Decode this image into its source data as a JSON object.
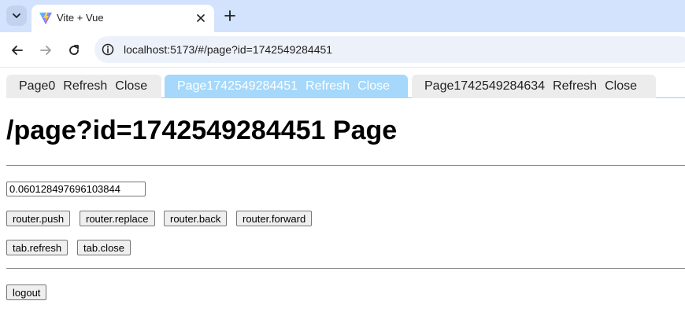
{
  "browser": {
    "tab_title": "Vite + Vue",
    "url": "localhost:5173/#/page?id=1742549284451",
    "brand_colors": {
      "tabstrip": "#d3e3fd",
      "omnibox": "#edf2fa"
    },
    "icons": {
      "tab_search": "chevron-down-icon",
      "favicon": "vite-logo-icon",
      "tab_close": "close-icon",
      "new_tab": "plus-icon",
      "back": "arrow-left-icon",
      "forward": "arrow-right-icon",
      "reload": "reload-icon",
      "site_info": "info-icon"
    }
  },
  "app": {
    "tabs": [
      {
        "title": "Page0",
        "refresh": "Refresh",
        "close": "Close",
        "active": false
      },
      {
        "title": "Page1742549284451",
        "refresh": "Refresh",
        "close": "Close",
        "active": true
      },
      {
        "title": "Page1742549284634",
        "refresh": "Refresh",
        "close": "Close",
        "active": false
      }
    ],
    "active_tab_color": "#a5d8fa",
    "inactive_tab_color": "#ececec",
    "heading": "/page?id=1742549284451 Page",
    "input_value": "0.060128497696103844",
    "router_buttons": [
      "router.push",
      "router.replace",
      "router.back",
      "router.forward"
    ],
    "tab_buttons": [
      "tab.refresh",
      "tab.close"
    ],
    "logout_label": "logout"
  }
}
